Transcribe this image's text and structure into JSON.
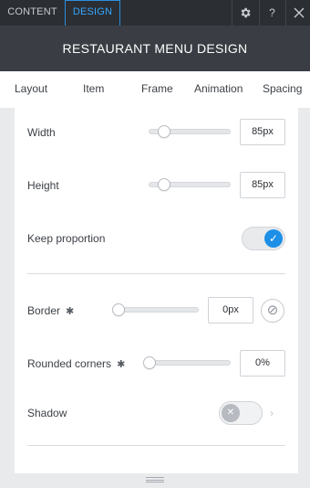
{
  "topbar": {
    "tabs": [
      {
        "label": "CONTENT",
        "active": false
      },
      {
        "label": "DESIGN",
        "active": true
      }
    ],
    "icons": [
      "gear-icon",
      "help-icon",
      "close-icon"
    ],
    "help_glyph": "?"
  },
  "header": {
    "title": "RESTAURANT MENU DESIGN"
  },
  "subtabs": [
    "Layout",
    "Item",
    "Frame",
    "Animation",
    "Spacing"
  ],
  "active_subtab": "Item",
  "settings": {
    "width": {
      "label": "Width",
      "value": "85px",
      "slider_level": 0.1
    },
    "height": {
      "label": "Height",
      "value": "85px",
      "slider_level": 0.1
    },
    "keep_proportion": {
      "label": "Keep proportion",
      "checked": true
    },
    "border": {
      "label": "Border",
      "value": "0px",
      "slider_level": 0
    },
    "rounded_corners": {
      "label": "Rounded corners",
      "value": "0%",
      "slider_level": 0
    },
    "shadow": {
      "label": "Shadow",
      "checked": false
    }
  },
  "colors": {
    "topbar_bg": "#2b2e33",
    "header_bg": "#3a3e44",
    "accent": "#1e8fe6",
    "design_tab": "#35a7ff"
  }
}
